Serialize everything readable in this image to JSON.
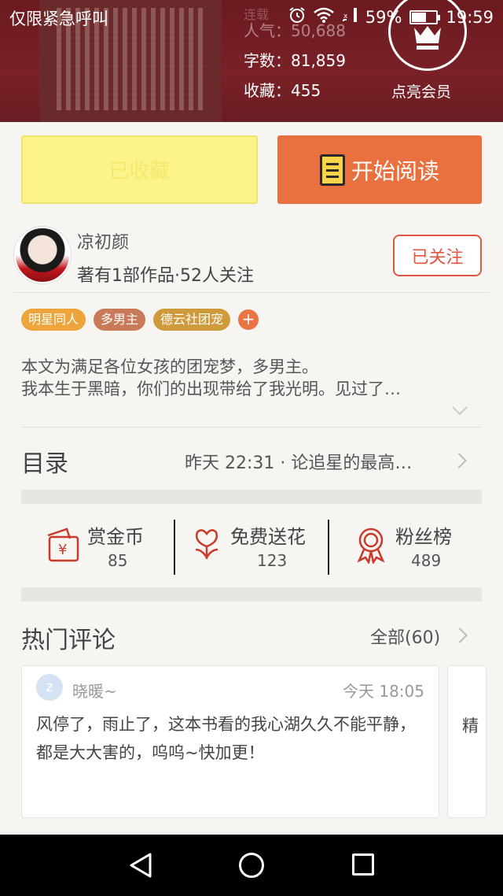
{
  "status_bar": {
    "carrier": "仅限紧急呼叫",
    "battery": "59%",
    "time": "19:59"
  },
  "book": {
    "status_partial": "连载",
    "popularity_label": "人气：",
    "popularity_value": "50,688",
    "word_count_label": "字数：",
    "word_count_value": "81,859",
    "favorites_label": "收藏：",
    "favorites_value": "455",
    "vip_label": "点亮会员"
  },
  "actions": {
    "collected_label": "已收藏",
    "start_reading_label": "开始阅读"
  },
  "author": {
    "name": "凉初颜",
    "meta": "著有1部作品·52人关注",
    "follow_label": "已关注"
  },
  "tags": [
    "明星同人",
    "多男主",
    "德云社团宠"
  ],
  "tags_more": "+",
  "description": {
    "line1": "本文为满足各位女孩的团宠梦，多男主。",
    "line2": "我本生于黑暗，你们的出现带给了我光明。见过了…"
  },
  "catalog": {
    "title": "目录",
    "latest": "昨天 22:31 · 论追星的最高…"
  },
  "rewards": [
    {
      "label": "赏金币",
      "count": "85",
      "icon": "coin-envelope-icon"
    },
    {
      "label": "免费送花",
      "count": "123",
      "icon": "flower-icon"
    },
    {
      "label": "粉丝榜",
      "count": "489",
      "icon": "medal-icon"
    }
  ],
  "comments": {
    "title": "热门评论",
    "all_label": "全部(60)",
    "items": [
      {
        "user": "晓暖~",
        "time": "今天 18:05",
        "text": "风停了，雨止了，这本书看的我心湖久久不能平静，都是大大害的，呜呜~快加更！"
      }
    ],
    "next_preview": "精"
  },
  "colors": {
    "header_bg": "#7a2128",
    "read_button": "#e9703f",
    "collected_button": "#fcf48a",
    "follow_accent": "#e0563f"
  }
}
